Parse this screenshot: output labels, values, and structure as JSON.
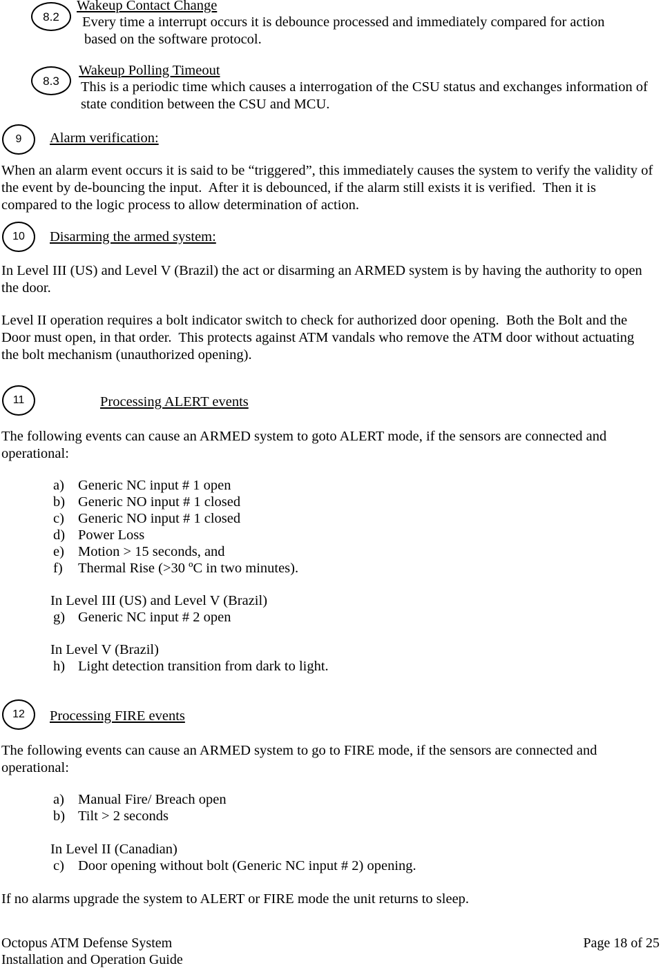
{
  "document": {
    "sections": [
      {
        "number": "8.2",
        "heading": "Wakeup Contact Change",
        "body_line_1": "Every time a interrupt occurs it is debounce processed and immediately compared for action",
        "body_line_2": "based on the software protocol."
      },
      {
        "number": "8.3",
        "heading": "Wakeup Polling Timeout",
        "body_line_1": "This is a periodic time which causes a interrogation of the CSU status and exchanges information of",
        "body_line_2": "state condition between the CSU and MCU."
      },
      {
        "number": "9",
        "heading": "Alarm verification:",
        "paragraph_line_1": "When an alarm event occurs it is said to be “triggered”, this immediately causes the system to verify the validity of",
        "paragraph_line_2": "the event by de-bouncing the input.  After it is debounced, if the alarm still exists it is verified.  Then it is",
        "paragraph_line_3": "compared to the logic process to allow determination of action."
      },
      {
        "number": "10",
        "heading": "Disarming the armed system:",
        "paragraph_1_line_1": "In Level III (US) and Level V (Brazil) the act or disarming an ARMED system is by having the authority to open",
        "paragraph_1_line_2": "the door.",
        "paragraph_2_line_1": "Level II operation requires a bolt indicator switch to check for authorized door opening.  Both the Bolt and the",
        "paragraph_2_line_2": "Door must open, in that order.  This protects against ATM vandals who remove the ATM door without actuating",
        "paragraph_2_line_3": "the bolt mechanism (unauthorized opening)."
      },
      {
        "number": "11",
        "heading": "Processing ALERT events",
        "intro_line_1": "The following events can cause an ARMED system to goto ALERT mode, if the sensors are connected and",
        "intro_line_2": "operational:",
        "items": [
          {
            "marker": "a)",
            "text": "Generic NC input # 1 open"
          },
          {
            "marker": "b)",
            "text": "Generic NO input # 1 closed"
          },
          {
            "marker": "c)",
            "text": "Generic NO input # 1 closed"
          },
          {
            "marker": "d)",
            "text": "Power Loss"
          },
          {
            "marker": "e)",
            "text": "Motion > 15 seconds, and"
          },
          {
            "marker": "f)",
            "text": "Thermal Rise (>30 ºC in two minutes)."
          }
        ],
        "subheading_1": "In Level III (US) and Level V (Brazil)",
        "items_2": [
          {
            "marker": "g)",
            "text": "Generic NC input # 2 open"
          }
        ],
        "subheading_2": "In Level V (Brazil)",
        "items_3": [
          {
            "marker": "h)",
            "text": "Light detection transition from dark to light."
          }
        ]
      },
      {
        "number": "12",
        "heading": "Processing FIRE events",
        "intro_line_1": "The following events can cause an ARMED system to go to FIRE mode, if the sensors are connected and",
        "intro_line_2": "operational:",
        "items": [
          {
            "marker": "a)",
            "text": "Manual Fire/ Breach open"
          },
          {
            "marker": "b)",
            "text": "Tilt > 2 seconds"
          }
        ],
        "subheading_1": "In Level II (Canadian)",
        "items_2": [
          {
            "marker": "c)",
            "text": "Door opening without bolt (Generic NC input # 2) opening."
          }
        ],
        "closing": "If no alarms upgrade the system to ALERT or FIRE mode the unit returns to sleep."
      }
    ],
    "footer": {
      "line_1": "Octopus ATM Defense System",
      "line_2": "Installation and Operation Guide",
      "page_label": "Page 18 of 25"
    }
  }
}
